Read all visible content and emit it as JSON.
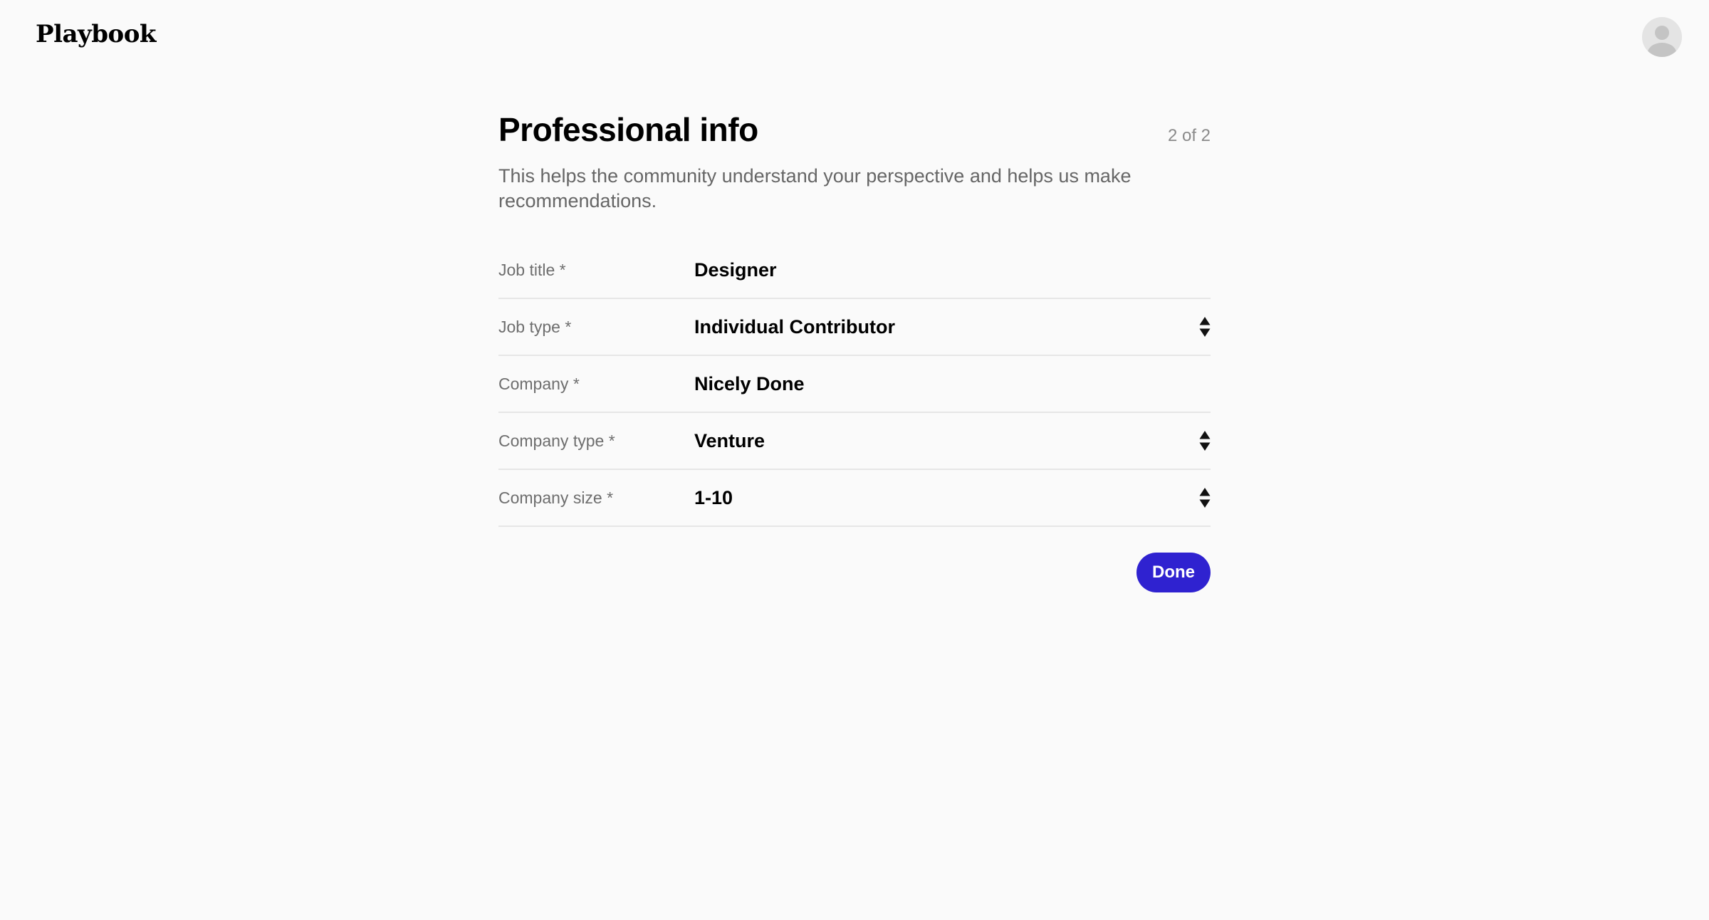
{
  "header": {
    "logo_text": "Playbook",
    "avatar_icon": "user-avatar-icon"
  },
  "page": {
    "title": "Professional info",
    "step": "2 of 2",
    "subtitle": "This helps the community understand your perspective and helps us make recommendations."
  },
  "form": {
    "job_title": {
      "label": "Job title *",
      "value": "Designer"
    },
    "job_type": {
      "label": "Job type *",
      "value": "Individual Contributor",
      "icon": "select-arrows-icon"
    },
    "company": {
      "label": "Company *",
      "value": "Nicely Done"
    },
    "company_type": {
      "label": "Company type *",
      "value": "Venture",
      "icon": "select-arrows-icon"
    },
    "company_size": {
      "label": "Company size *",
      "value": "1-10",
      "icon": "select-arrows-icon"
    }
  },
  "actions": {
    "done_label": "Done"
  },
  "colors": {
    "background": "#fafafa",
    "accent": "#2f22d0",
    "divider": "#e6e6e6",
    "muted_text": "#6e6e6e"
  }
}
